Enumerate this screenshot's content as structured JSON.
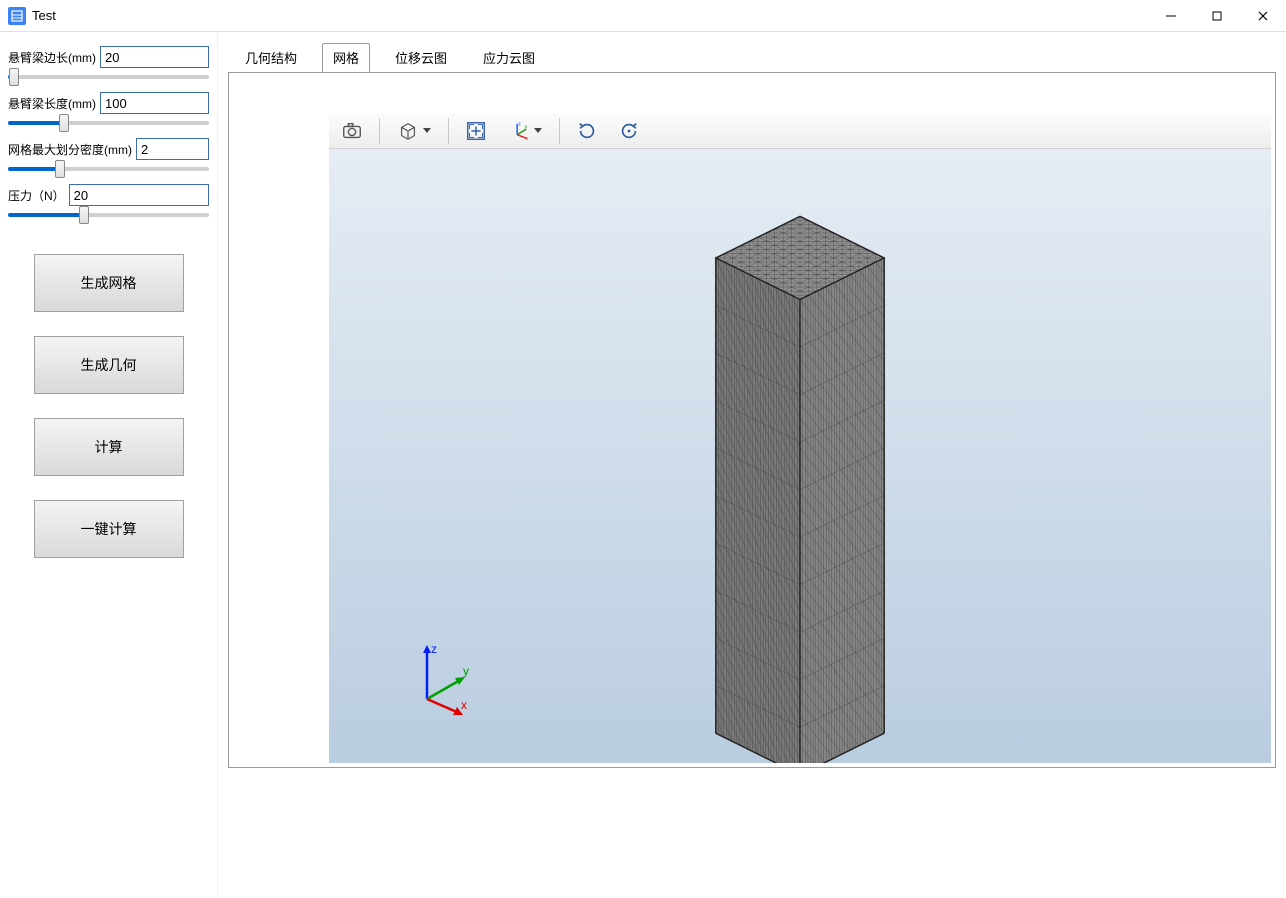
{
  "window": {
    "title": "Test"
  },
  "sidebar": {
    "params": [
      {
        "label": "悬臂梁边长(mm)",
        "value": "20",
        "slider_pct": 3
      },
      {
        "label": "悬臂梁长度(mm)",
        "value": "100",
        "slider_pct": 28
      },
      {
        "label": "网格最大划分密度(mm)",
        "value": "2",
        "slider_pct": 26
      },
      {
        "label": "压力（N）",
        "value": "20",
        "slider_pct": 38
      }
    ],
    "buttons": {
      "generate_mesh": "生成网格",
      "generate_geometry": "生成几何",
      "compute": "计算",
      "one_click_compute": "一键计算"
    }
  },
  "tabs": {
    "items": [
      "几何结构",
      "网格",
      "位移云图",
      "应力云图"
    ],
    "active_index": 1
  },
  "viewport": {
    "toolbar_icons": [
      "camera-icon",
      "cube-view-icon",
      "fit-extents-icon",
      "axes-xyz-icon",
      "rotate-ccw-icon",
      "rotate-reset-icon"
    ],
    "axes": {
      "x": "x",
      "y": "y",
      "z": "z"
    }
  }
}
